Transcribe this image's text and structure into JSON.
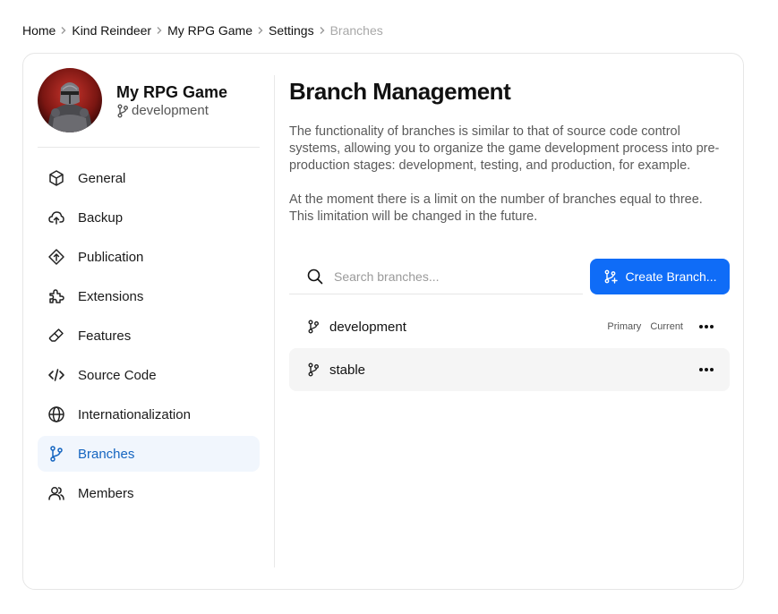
{
  "breadcrumb": [
    "Home",
    "Kind Reindeer",
    "My RPG Game",
    "Settings",
    "Branches"
  ],
  "project": {
    "name": "My RPG Game",
    "branch": "development"
  },
  "nav": [
    {
      "label": "General",
      "icon": "cube-icon"
    },
    {
      "label": "Backup",
      "icon": "cloud-upload-icon"
    },
    {
      "label": "Publication",
      "icon": "publish-icon"
    },
    {
      "label": "Extensions",
      "icon": "puzzle-icon"
    },
    {
      "label": "Features",
      "icon": "eraser-icon"
    },
    {
      "label": "Source Code",
      "icon": "code-icon"
    },
    {
      "label": "Internationalization",
      "icon": "globe-icon"
    },
    {
      "label": "Branches",
      "icon": "branch-icon",
      "active": true
    },
    {
      "label": "Members",
      "icon": "members-icon"
    }
  ],
  "main": {
    "title": "Branch Management",
    "description": [
      "The functionality of branches is similar to that of source code control systems, allowing you to organize the game development process into pre-production stages: development, testing, and production, for example.",
      "At the moment there is a limit on the number of branches equal to three. This limitation will be changed in the future."
    ],
    "search_placeholder": "Search branches...",
    "create_label": "Create Branch...",
    "branches": [
      {
        "name": "development",
        "tags": [
          "Primary",
          "Current"
        ]
      },
      {
        "name": "stable",
        "tags": []
      }
    ]
  },
  "colors": {
    "accent": "#0f6cf7",
    "active_nav_bg": "#f1f6fd",
    "active_nav_text": "#1565c0"
  }
}
